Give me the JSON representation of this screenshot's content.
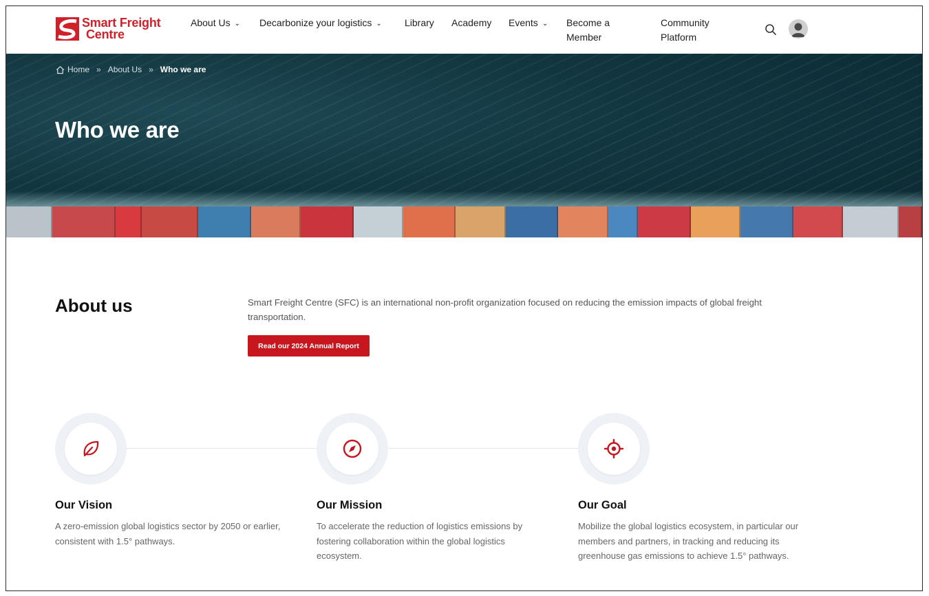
{
  "brand": {
    "line1": "Smart Freight",
    "line2": "Centre",
    "color": "#d1202a"
  },
  "nav": {
    "items": [
      {
        "label": "About Us",
        "has_dropdown": true
      },
      {
        "label": "Decarbonize your logistics",
        "has_dropdown": true
      },
      {
        "label": "Library",
        "has_dropdown": false
      },
      {
        "label": "Academy",
        "has_dropdown": false
      },
      {
        "label": "Events",
        "has_dropdown": true
      },
      {
        "label_line1": "Become a",
        "label_line2": "Member",
        "has_dropdown": false
      },
      {
        "label_line1": "Community",
        "label_line2": "Platform",
        "has_dropdown": false
      }
    ],
    "icons": [
      "search-icon",
      "user-avatar-icon"
    ]
  },
  "hero": {
    "breadcrumb": {
      "home": "Home",
      "parent": "About Us",
      "current": "Who we are"
    },
    "title": "Who we are"
  },
  "about": {
    "heading": "About us",
    "text": "Smart Freight Centre (SFC) is an international non-profit organization focused on reducing the emission impacts of global freight transportation.",
    "button": "Read our 2024 Annual Report"
  },
  "pillars": [
    {
      "icon": "leaf-icon",
      "title": "Our Vision",
      "text": "A zero-emission global logistics sector by 2050 or earlier, consistent with 1.5° pathways."
    },
    {
      "icon": "compass-icon",
      "title": "Our Mission",
      "text": "To accelerate the reduction of logistics emissions by fostering collaboration within the global logistics ecosystem."
    },
    {
      "icon": "target-icon",
      "title": "Our Goal",
      "text": "Mobilize the global logistics ecosystem, in particular our members and partners, in tracking and reducing its greenhouse gas emissions to achieve 1.5° pathways."
    }
  ],
  "colors": {
    "accent": "#c8161e",
    "hero_sea": "#123640",
    "text_muted": "#666666"
  }
}
